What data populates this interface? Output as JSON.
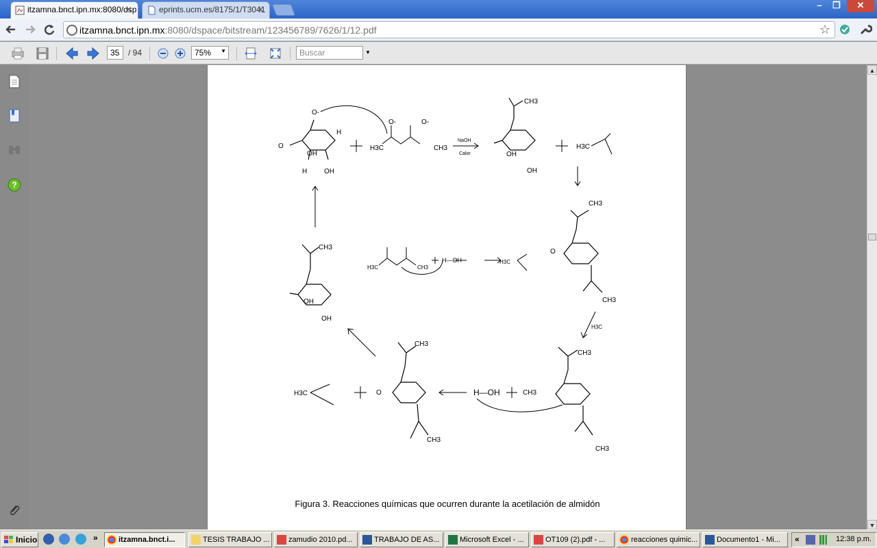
{
  "browser": {
    "tabs": [
      {
        "title": "itzamna.bnct.ipn.mx:8080/dsp",
        "active": true
      },
      {
        "title": "eprints.ucm.es/8175/1/T3041",
        "active": false
      }
    ],
    "window_controls": {
      "minimize": "–",
      "maximize": "❐",
      "close": "✕"
    },
    "address": {
      "host": "itzamna.bnct.ipn.mx",
      "rest": ":8080/dspace/bitstream/123456789/7626/1/12.pdf"
    }
  },
  "pdf_toolbar": {
    "page_current": "35",
    "page_total": "/ 94",
    "zoom": "75%",
    "search_placeholder": "Buscar"
  },
  "document": {
    "caption": "Figura 3. Reacciones químicas que ocurren durante la acetilación de almidón",
    "reaction": {
      "reagent_top": "NaOH",
      "condition_top": "Calor",
      "water": "H—OH",
      "labels": {
        "h3c": "H3C",
        "ch3": "CH3",
        "o": "O",
        "o_minus": "O-",
        "h": "H",
        "oh": "OH"
      }
    }
  },
  "taskbar": {
    "start": "Inicio",
    "tasks": [
      {
        "label": "itzamna.bnct.i...",
        "active": true
      },
      {
        "label": "TESIS TRABAJO ...",
        "active": false
      },
      {
        "label": "zamudio 2010.pd...",
        "active": false
      },
      {
        "label": "TRABAJO DE AS...",
        "active": false
      },
      {
        "label": "Microsoft Excel - ...",
        "active": false
      },
      {
        "label": "OT109 (2).pdf - ...",
        "active": false
      },
      {
        "label": "reacciones quimic...",
        "active": false
      },
      {
        "label": "Documento1 - Mi...",
        "active": false
      }
    ],
    "clock": "12:38 p.m."
  }
}
